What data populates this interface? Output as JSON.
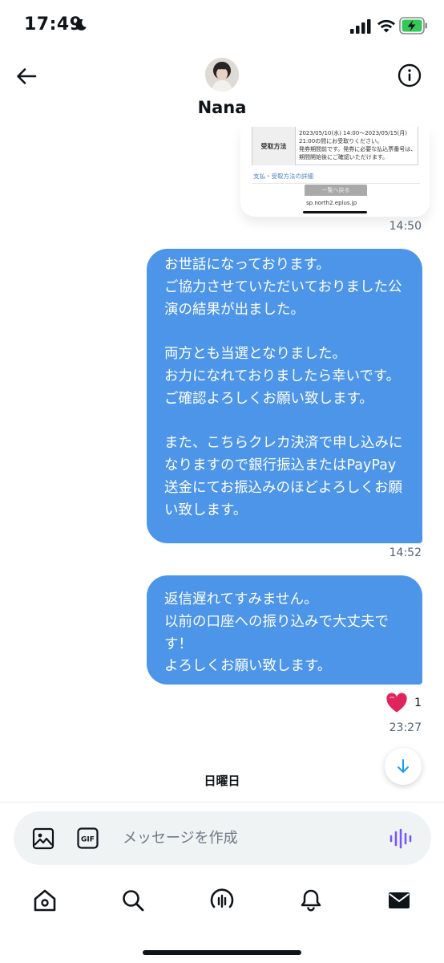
{
  "status_bar": {
    "time": "17:49"
  },
  "header": {
    "contact_name": "Nana"
  },
  "attachment": {
    "table_label": "受取方法",
    "table_detail": "2023/05/10(水) 14:00～2023/05/15(月) 21:00の間にお受取りください。\n発券期間前です。発券に必要な払込票番号は、期間開始後にご確認いただけます。",
    "link_text": "支払・受取方法の詳細",
    "button_text": "一覧へ戻る",
    "url_text": "sp.north2.eplus.jp"
  },
  "messages": [
    {
      "time": "14:50"
    },
    {
      "text": "お世話になっております。\nご協力させていただいておりました公演の結果が出ました。\n\n両方とも当選となりました。\nお力になれておりましたら幸いです。\nご確認よろしくお願い致します。\n\nまた、こちらクレカ決済で申し込みになりますので銀行振込またはPayPay送金にてお振込みのほどよろしくお願い致します。",
      "time": "14:52"
    },
    {
      "text": "返信遅れてすみません。\n以前の口座への振り込みで大丈夫です！\nよろしくお願い致します。",
      "time": "23:27",
      "reaction_count": "1"
    }
  ],
  "day_divider": "日曜日",
  "composer": {
    "placeholder": "メッセージを作成"
  },
  "colors": {
    "bubble": "#4d95e8",
    "accent": "#1d9bf0",
    "voice": "#7856ff",
    "heart": "#e0245e"
  }
}
